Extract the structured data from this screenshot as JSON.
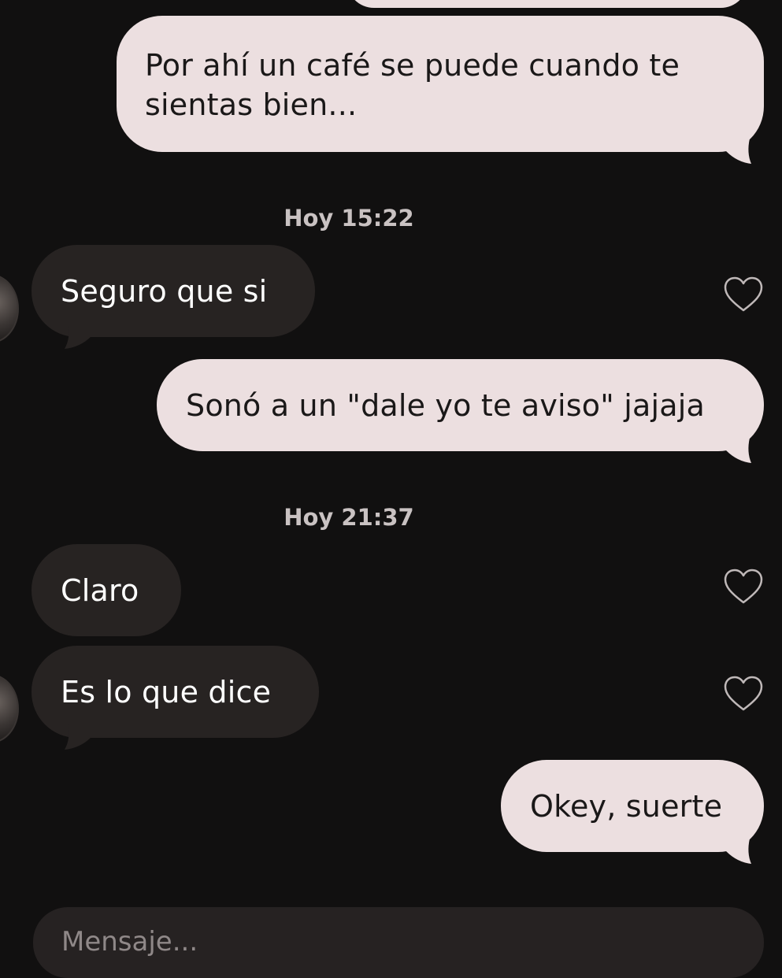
{
  "conversation": {
    "messages": [
      {
        "direction": "sent",
        "text": "Por ahí un café se puede cuando te sientas bien..."
      },
      {
        "direction": "timestamp",
        "text": "Hoy 15:22"
      },
      {
        "direction": "received",
        "text": "Seguro que si"
      },
      {
        "direction": "sent",
        "text": "Sonó a un \"dale yo te aviso\" jajaja"
      },
      {
        "direction": "timestamp",
        "text": "Hoy 21:37"
      },
      {
        "direction": "received",
        "text": "Claro"
      },
      {
        "direction": "received",
        "text": "Es lo que dice"
      },
      {
        "direction": "sent",
        "text": "Okey, suerte"
      }
    ]
  },
  "composer": {
    "placeholder": "Mensaje..."
  },
  "icons": {
    "like": "heart-outline-icon"
  },
  "colors": {
    "background": "#111010",
    "sent_bubble": "#ecdfe0",
    "received_bubble": "#272322",
    "timestamp_text": "#c9c2c2"
  }
}
